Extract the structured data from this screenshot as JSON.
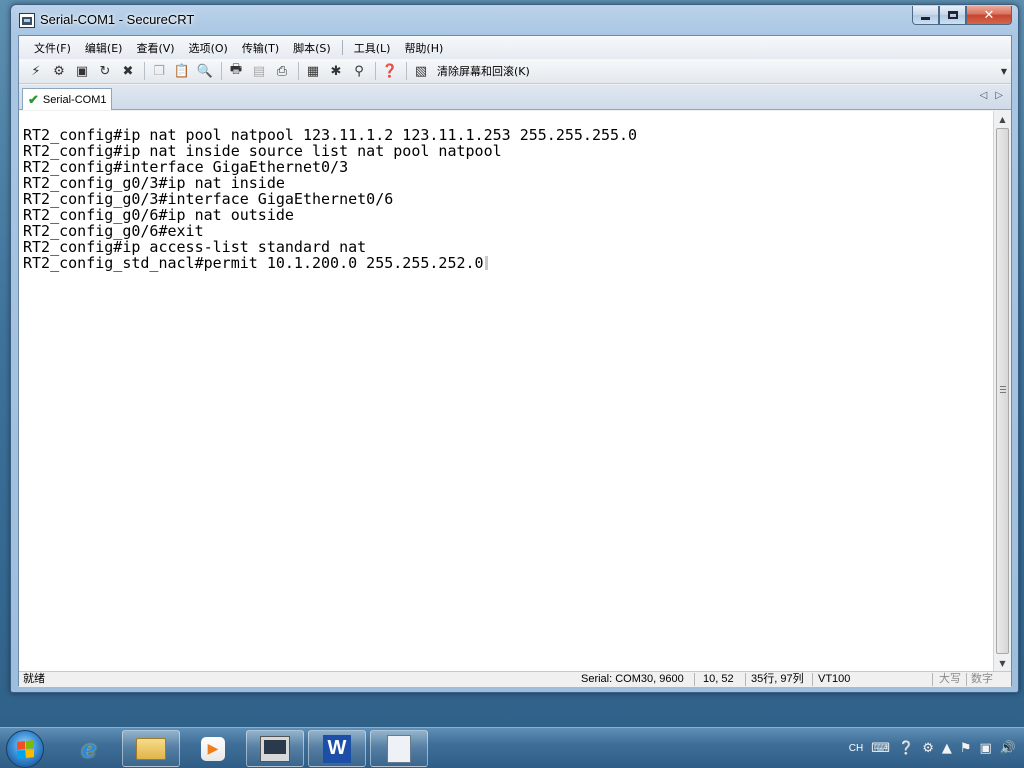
{
  "window": {
    "title": "Serial-COM1 - SecureCRT",
    "minimize_glyph": "minimize-icon",
    "maximize_glyph": "maximize-icon",
    "close_glyph": "close-icon"
  },
  "menu": [
    {
      "label": "文件(F)"
    },
    {
      "label": "编辑(E)"
    },
    {
      "label": "查看(V)"
    },
    {
      "label": "选项(O)"
    },
    {
      "label": "传输(T)"
    },
    {
      "label": "脚本(S)"
    },
    {
      "label": "工具(L)"
    },
    {
      "label": "帮助(H)"
    }
  ],
  "toolbar": {
    "clear_label": "清除屏幕和回滚(K)"
  },
  "tab": {
    "label": "Serial-COM1"
  },
  "terminal": {
    "lines": [
      "RT2_config#ip nat pool natpool 123.11.1.2 123.11.1.253 255.255.255.0",
      "RT2_config#ip nat inside source list nat pool natpool",
      "RT2_config#interface GigaEthernet0/3",
      "RT2_config_g0/3#ip nat inside",
      "RT2_config_g0/3#interface GigaEthernet0/6",
      "RT2_config_g0/6#ip nat outside",
      "RT2_config_g0/6#exit",
      "RT2_config#ip access-list standard nat",
      "RT2_config_std_nacl#permit 10.1.200.0 255.255.252.0"
    ]
  },
  "status": {
    "ready": "就绪",
    "connection": "Serial: COM30, 9600",
    "cursor_pos": "10,  52",
    "size": "35行, 97列",
    "emulation": "VT100",
    "caps": "大写",
    "num": "数字"
  },
  "taskbar": {
    "lang": "CH"
  }
}
